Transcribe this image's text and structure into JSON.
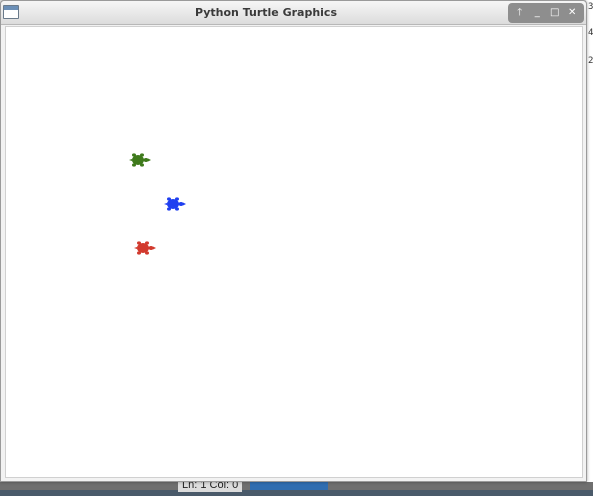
{
  "window": {
    "title": "Python Turtle Graphics",
    "controls": [
      {
        "name": "restore-icon",
        "glyph": "🡑"
      },
      {
        "name": "minimize-icon",
        "glyph": "_"
      },
      {
        "name": "maximize-icon",
        "glyph": "□"
      },
      {
        "name": "close-icon",
        "glyph": "✕"
      }
    ]
  },
  "canvas": {
    "background": "#ffffff",
    "turtles": [
      {
        "name": "green-turtle",
        "color": "#3f7a1c",
        "heading": "east"
      },
      {
        "name": "blue-turtle",
        "color": "#1f3ff0",
        "heading": "east"
      },
      {
        "name": "red-turtle",
        "color": "#d23a2e",
        "heading": "east"
      }
    ]
  },
  "background_window": {
    "status_text": "Ln: 1   Col: 0",
    "edge_digits": [
      "3",
      "4",
      "2"
    ]
  }
}
